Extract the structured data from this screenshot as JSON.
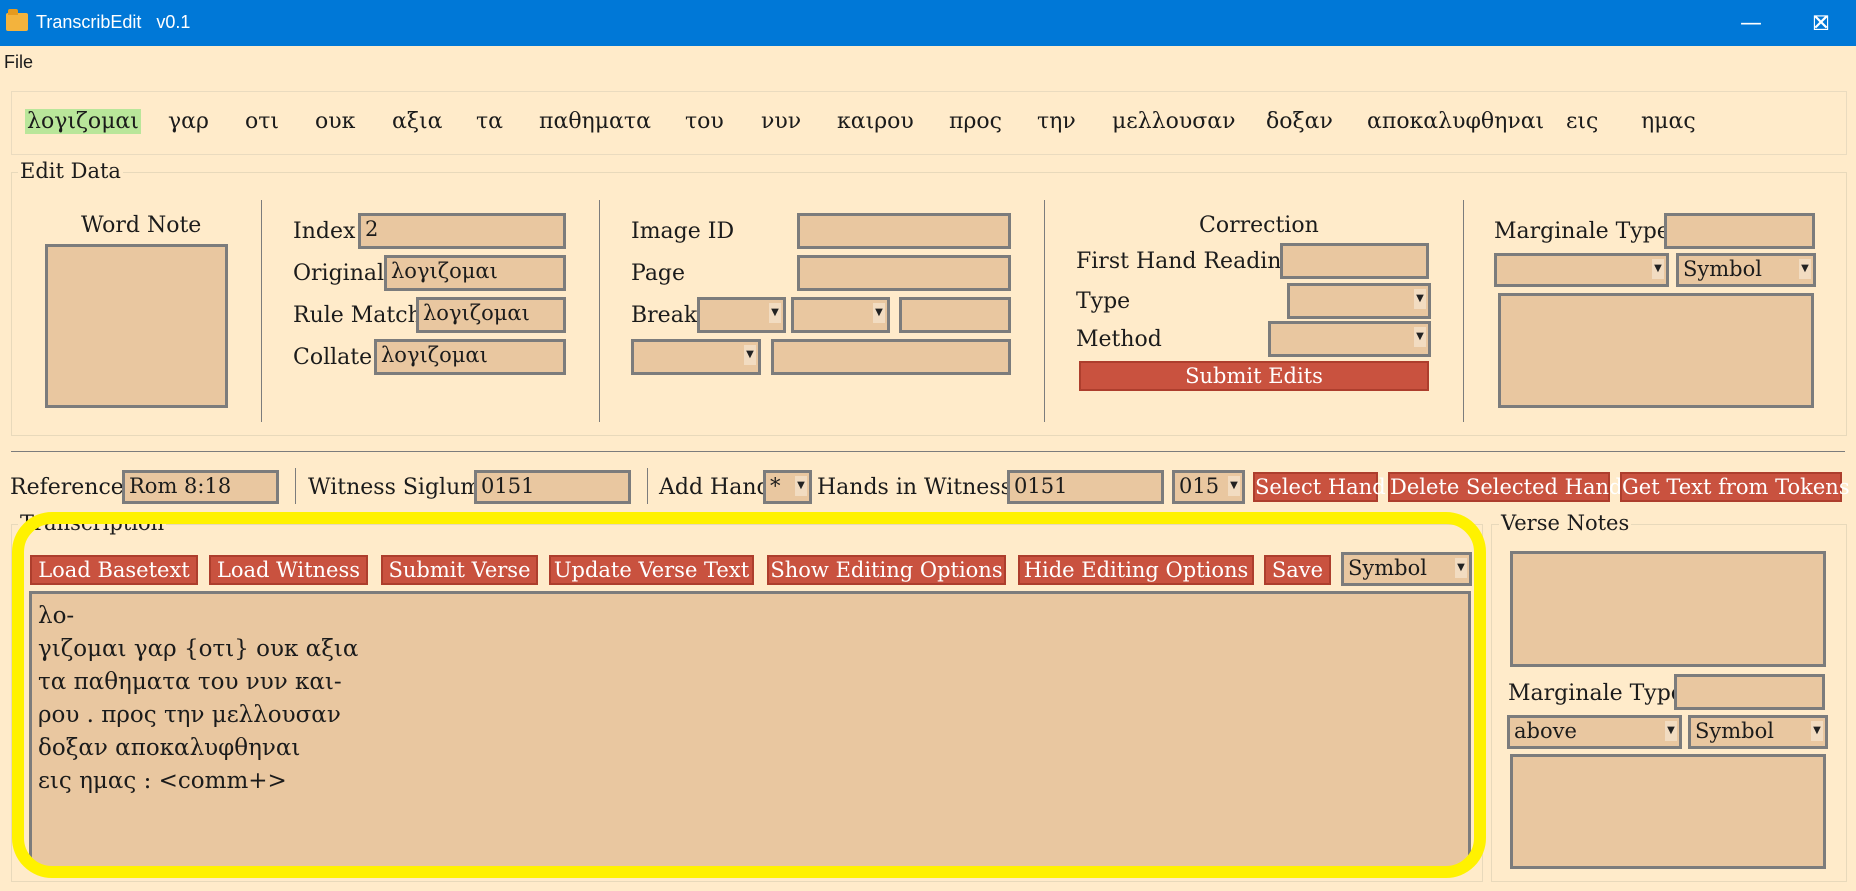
{
  "window": {
    "title": "TranscribEdit   v0.1",
    "minimize": "—",
    "maximize": "☐",
    "close": "✕"
  },
  "menu": {
    "file": "File"
  },
  "words": [
    "λογιζομαι",
    "γαρ",
    "οτι",
    "ουκ",
    "αξια",
    "τα",
    "παθηματα",
    "του",
    "νυν",
    "καιρου",
    "προς",
    "την",
    "μελλουσαν",
    "δοξαν",
    "αποκαλυφθηναι",
    "εις",
    "ημας"
  ],
  "edit_data": {
    "title": "Edit Data",
    "word_note": "Word Note",
    "index_label": "Index",
    "index_value": "2",
    "original_label": "Original",
    "original_value": "λογιζομαι",
    "rule_match_label": "Rule Match",
    "rule_match_value": "λογιζομαι",
    "collate_label": "Collate",
    "collate_value": "λογιζομαι",
    "image_id_label": "Image ID",
    "image_id_value": "",
    "page_label": "Page",
    "page_value": "",
    "break_label": "Break",
    "correction_title": "Correction",
    "first_hand_label": "First Hand Reading",
    "type_label": "Type",
    "method_label": "Method",
    "submit_edits": "Submit Edits",
    "marginale_type_label": "Marginale Type",
    "marginale_symbol": "Symbol"
  },
  "witness_bar": {
    "reference_label": "Reference",
    "reference_value": "Rom 8:18",
    "siglum_label": "Witness Siglum",
    "siglum_value": "0151",
    "add_hand_label": "Add Hand",
    "add_hand_value": "*",
    "hands_label": "Hands in Witness:",
    "hands_value": "0151",
    "hands_combo": "015",
    "select_hand": "Select Hand",
    "delete_hand": "Delete Selected Hand",
    "get_text": "Get Text from Tokens"
  },
  "transcription": {
    "title": "Transcription",
    "buttons": {
      "load_basetext": "Load Basetext",
      "load_witness": "Load Witness",
      "submit_verse": "Submit Verse",
      "update_verse": "Update Verse Text",
      "show_editing": "Show Editing Options",
      "hide_editing": "Hide Editing Options",
      "save": "Save"
    },
    "symbol": "Symbol",
    "text": "λο-\nγιζομαι γαρ {οτι} ουκ αξια\nτα παθηματα του νυν και-\nρου . προς την μελλουσαν\nδοξαν αποκαλυφθηναι\nεις ημας : <comm+>"
  },
  "verse_notes": {
    "title": "Verse Notes",
    "marginale_type_label": "Marginale Type",
    "position": "above",
    "symbol": "Symbol"
  },
  "colors": {
    "title_bar": "#0078d7",
    "background": "#ffebca",
    "button": "#c9523f",
    "entry": "#e9c7a0",
    "selected_word": "#b9e69a",
    "highlight": "#fff200"
  }
}
